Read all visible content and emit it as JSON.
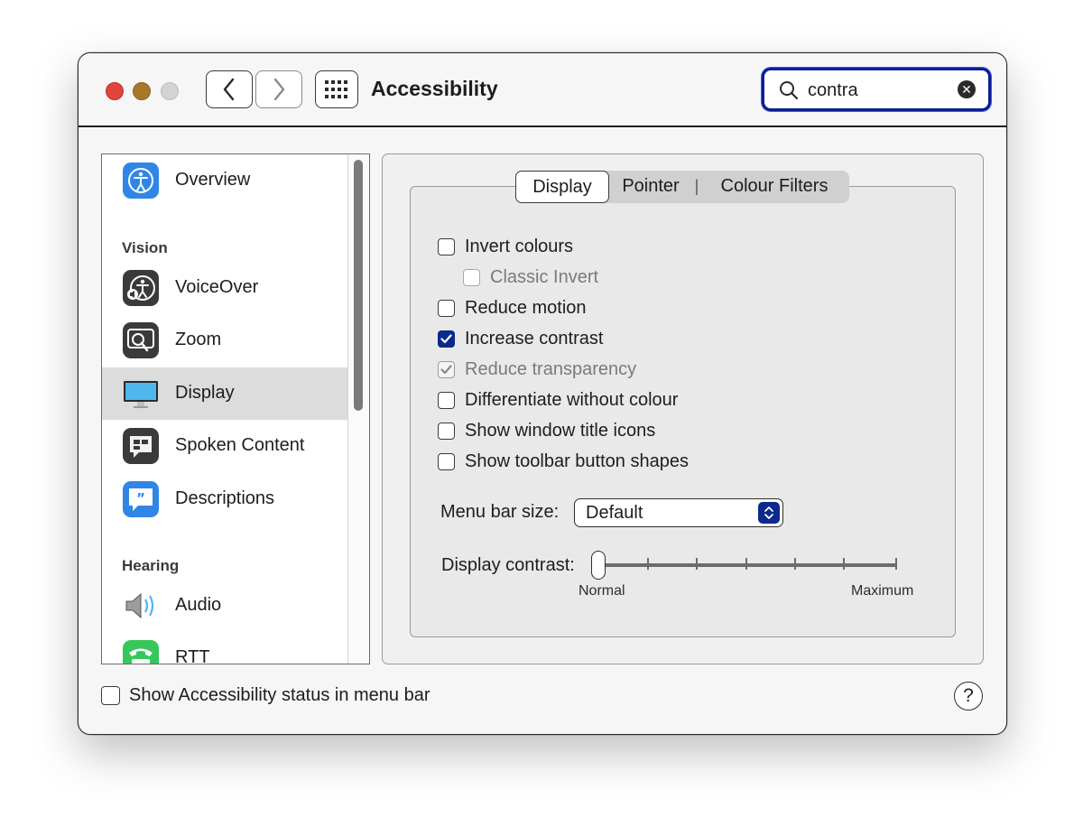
{
  "window": {
    "title": "Accessibility"
  },
  "search": {
    "value": "contra"
  },
  "sidebar": {
    "items": [
      {
        "label": "Overview",
        "icon": "overview-icon"
      },
      {
        "label": "VoiceOver",
        "icon": "voiceover-icon"
      },
      {
        "label": "Zoom",
        "icon": "zoom-icon"
      },
      {
        "label": "Display",
        "icon": "display-icon",
        "selected": true
      },
      {
        "label": "Spoken Content",
        "icon": "spoken-content-icon"
      },
      {
        "label": "Descriptions",
        "icon": "descriptions-icon"
      },
      {
        "label": "Audio",
        "icon": "audio-icon"
      },
      {
        "label": "RTT",
        "icon": "rtt-icon"
      }
    ],
    "sections": {
      "vision": "Vision",
      "hearing": "Hearing"
    }
  },
  "tabs": {
    "display": "Display",
    "pointer": "Pointer",
    "separator": "|",
    "colour_filters": "Colour Filters",
    "selected": "Display"
  },
  "options": [
    {
      "label": "Invert colours",
      "checked": false,
      "enabled": true
    },
    {
      "label": "Classic Invert",
      "checked": false,
      "enabled": false
    },
    {
      "label": "Reduce motion",
      "checked": false,
      "enabled": true
    },
    {
      "label": "Increase contrast",
      "checked": true,
      "enabled": true
    },
    {
      "label": "Reduce transparency",
      "checked": true,
      "enabled": false
    },
    {
      "label": "Differentiate without colour",
      "checked": false,
      "enabled": true
    },
    {
      "label": "Show window title icons",
      "checked": false,
      "enabled": true
    },
    {
      "label": "Show toolbar button shapes",
      "checked": false,
      "enabled": true
    }
  ],
  "menu_bar_size": {
    "label": "Menu bar size:",
    "value": "Default"
  },
  "display_contrast": {
    "label": "Display contrast:",
    "min_label": "Normal",
    "max_label": "Maximum",
    "level": 0
  },
  "footer": {
    "status_label": "Show Accessibility status in menu bar",
    "status_checked": false,
    "help_label": "?"
  },
  "colors": {
    "accent": "#0c2a8c",
    "close": "#e0443e",
    "minimize": "#a8772a",
    "zoom": "#d3d3d3"
  }
}
